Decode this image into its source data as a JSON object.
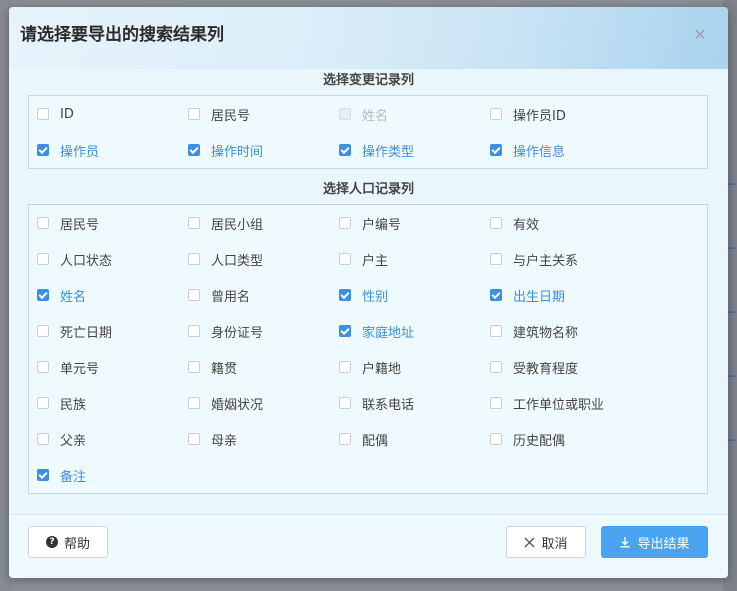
{
  "dialog": {
    "title": "请选择要导出的搜索结果列",
    "close_glyph": "✕"
  },
  "change_section": {
    "title": "选择变更记录列",
    "items": [
      {
        "label": "ID",
        "state": "unchecked"
      },
      {
        "label": "居民号",
        "state": "unchecked"
      },
      {
        "label": "姓名",
        "state": "disabled"
      },
      {
        "label": "操作员ID",
        "state": "unchecked"
      },
      {
        "label": "操作员",
        "state": "checked"
      },
      {
        "label": "操作时间",
        "state": "checked"
      },
      {
        "label": "操作类型",
        "state": "checked"
      },
      {
        "label": "操作信息",
        "state": "checked"
      }
    ]
  },
  "population_section": {
    "title": "选择人口记录列",
    "items": [
      {
        "label": "居民号",
        "state": "unchecked"
      },
      {
        "label": "居民小组",
        "state": "unchecked"
      },
      {
        "label": "户编号",
        "state": "unchecked"
      },
      {
        "label": "有效",
        "state": "unchecked"
      },
      {
        "label": "人口状态",
        "state": "unchecked"
      },
      {
        "label": "人口类型",
        "state": "unchecked"
      },
      {
        "label": "户主",
        "state": "unchecked"
      },
      {
        "label": "与户主关系",
        "state": "unchecked"
      },
      {
        "label": "姓名",
        "state": "checked"
      },
      {
        "label": "曾用名",
        "state": "unchecked"
      },
      {
        "label": "性别",
        "state": "checked"
      },
      {
        "label": "出生日期",
        "state": "checked"
      },
      {
        "label": "死亡日期",
        "state": "unchecked"
      },
      {
        "label": "身份证号",
        "state": "unchecked"
      },
      {
        "label": "家庭地址",
        "state": "checked"
      },
      {
        "label": "建筑物名称",
        "state": "unchecked"
      },
      {
        "label": "单元号",
        "state": "unchecked"
      },
      {
        "label": "籍贯",
        "state": "unchecked"
      },
      {
        "label": "户籍地",
        "state": "unchecked"
      },
      {
        "label": "受教育程度",
        "state": "unchecked"
      },
      {
        "label": "民族",
        "state": "unchecked"
      },
      {
        "label": "婚姻状况",
        "state": "unchecked"
      },
      {
        "label": "联系电话",
        "state": "unchecked"
      },
      {
        "label": "工作单位或职业",
        "state": "unchecked"
      },
      {
        "label": "父亲",
        "state": "unchecked"
      },
      {
        "label": "母亲",
        "state": "unchecked"
      },
      {
        "label": "配偶",
        "state": "unchecked"
      },
      {
        "label": "历史配偶",
        "state": "unchecked"
      },
      {
        "label": "备注",
        "state": "checked"
      }
    ]
  },
  "footer": {
    "help_label": "帮助",
    "help_icon": "question-circle-icon",
    "cancel_label": "取消",
    "cancel_icon": "close-icon",
    "export_label": "导出结果",
    "export_icon": "download-icon"
  },
  "colors": {
    "accent": "#3d8fe0",
    "primary_button": "#4aa3f0",
    "dialog_bg": "#e9f7fc"
  }
}
